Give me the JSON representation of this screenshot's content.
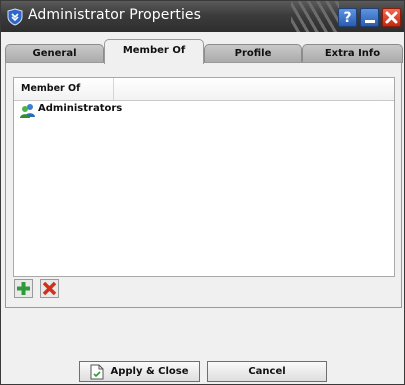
{
  "window": {
    "title": "Administrator Properties",
    "help_label": "?",
    "accent_blue": "#2a5bb0",
    "close_red": "#c7270e"
  },
  "tabs": [
    {
      "label": "General",
      "active": false
    },
    {
      "label": "Member Of",
      "active": true
    },
    {
      "label": "Profile",
      "active": false
    },
    {
      "label": "Extra Info",
      "active": false
    }
  ],
  "member_list": {
    "column_header": "Member Of",
    "rows": [
      {
        "label": "Administrators",
        "icon": "user-group-icon"
      }
    ]
  },
  "list_actions": {
    "add_icon": "plus-icon",
    "remove_icon": "x-icon"
  },
  "footer": {
    "apply_label": "Apply & Close",
    "cancel_label": "Cancel"
  }
}
